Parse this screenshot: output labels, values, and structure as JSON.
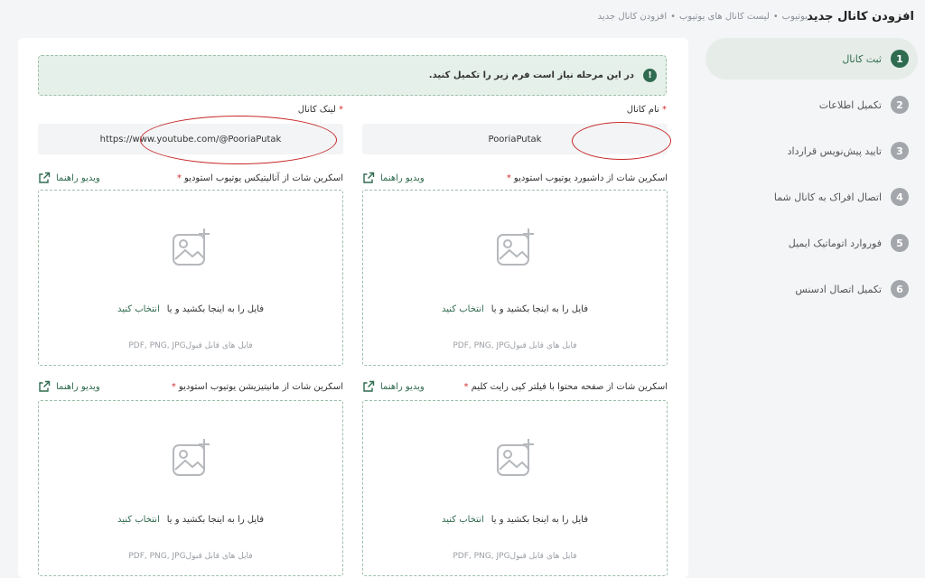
{
  "header": {
    "page_title": "افزودن کانال جدید",
    "breadcrumb": [
      "یوتیوب",
      "لیست کانال های یوتیوب",
      "افزودن کانال جدید"
    ]
  },
  "steps": [
    {
      "num": "1",
      "label": "ثبت کانال",
      "active": true
    },
    {
      "num": "2",
      "label": "تکمیل اطلاعات",
      "active": false
    },
    {
      "num": "3",
      "label": "تایید پیش‌نویس قرارداد",
      "active": false
    },
    {
      "num": "4",
      "label": "اتصال افراک به کانال شما",
      "active": false
    },
    {
      "num": "5",
      "label": "فوروارد اتوماتیک ایمیل",
      "active": false
    },
    {
      "num": "6",
      "label": "تکمیل اتصال ادسنس",
      "active": false
    }
  ],
  "alert": {
    "icon": "!",
    "text": "در این مرحله نیاز است فرم زیر را تکمیل کنید."
  },
  "fields": {
    "channel_name": {
      "label": "نام کانال",
      "value": "PooriaPutak"
    },
    "channel_link": {
      "label": "لینک کانال",
      "value": "https://www.youtube.com/@PooriaPutak"
    }
  },
  "uploads": [
    {
      "label": "اسکرین شات از داشبورد یوتیوب استودیو",
      "video_link": "ویدیو راهنما"
    },
    {
      "label": "اسکرین شات از آنالیتیکس یوتیوب استودیو",
      "video_link": "ویدیو راهنما"
    },
    {
      "label": "اسکرین شات از صفحه محتوا با فیلتر کپی رایت کلیم",
      "video_link": "ویدیو راهنما"
    },
    {
      "label": "اسکرین شات از مانیتیزیشن یوتیوب استودیو",
      "video_link": "ویدیو راهنما"
    }
  ],
  "dropzone": {
    "drag_text": "فایل را به اینجا بکشید و یا",
    "choose_text": "انتخاب کنید",
    "formats_text": "فایل های قابل قبولPDF, PNG, JPG"
  },
  "colors": {
    "accent": "#2f6b4f",
    "required": "#d32f2f",
    "highlight_ellipse": "#c62828"
  }
}
